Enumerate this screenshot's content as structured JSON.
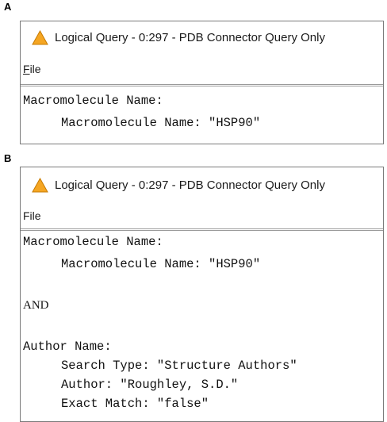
{
  "panel_a": {
    "letter": "A",
    "title": "Logical Query - 0:297 - PDB Connector Query Only",
    "menu": {
      "file_first": "F",
      "file_rest": "ile"
    },
    "content": {
      "group1_header": "Macromolecule Name:",
      "group1_line1": "Macromolecule Name: \"HSP90\""
    }
  },
  "panel_b": {
    "letter": "B",
    "title": "Logical Query - 0:297 - PDB Connector Query Only",
    "menu": {
      "file": "File"
    },
    "content": {
      "group1_header": "Macromolecule Name:",
      "group1_line1": "Macromolecule Name: \"HSP90\"",
      "operator": "AND",
      "group2_header": "Author Name:",
      "group2_line1": "Search Type: \"Structure Authors\"",
      "group2_line2": "Author: \"Roughley, S.D.\"",
      "group2_line3": "Exact Match: \"false\""
    }
  },
  "colors": {
    "warning_fill": "#f5a623",
    "warning_stroke": "#c77a00",
    "window_border": "#7a7a7a"
  },
  "icons": {
    "title_icon": "warning-triangle-icon"
  }
}
